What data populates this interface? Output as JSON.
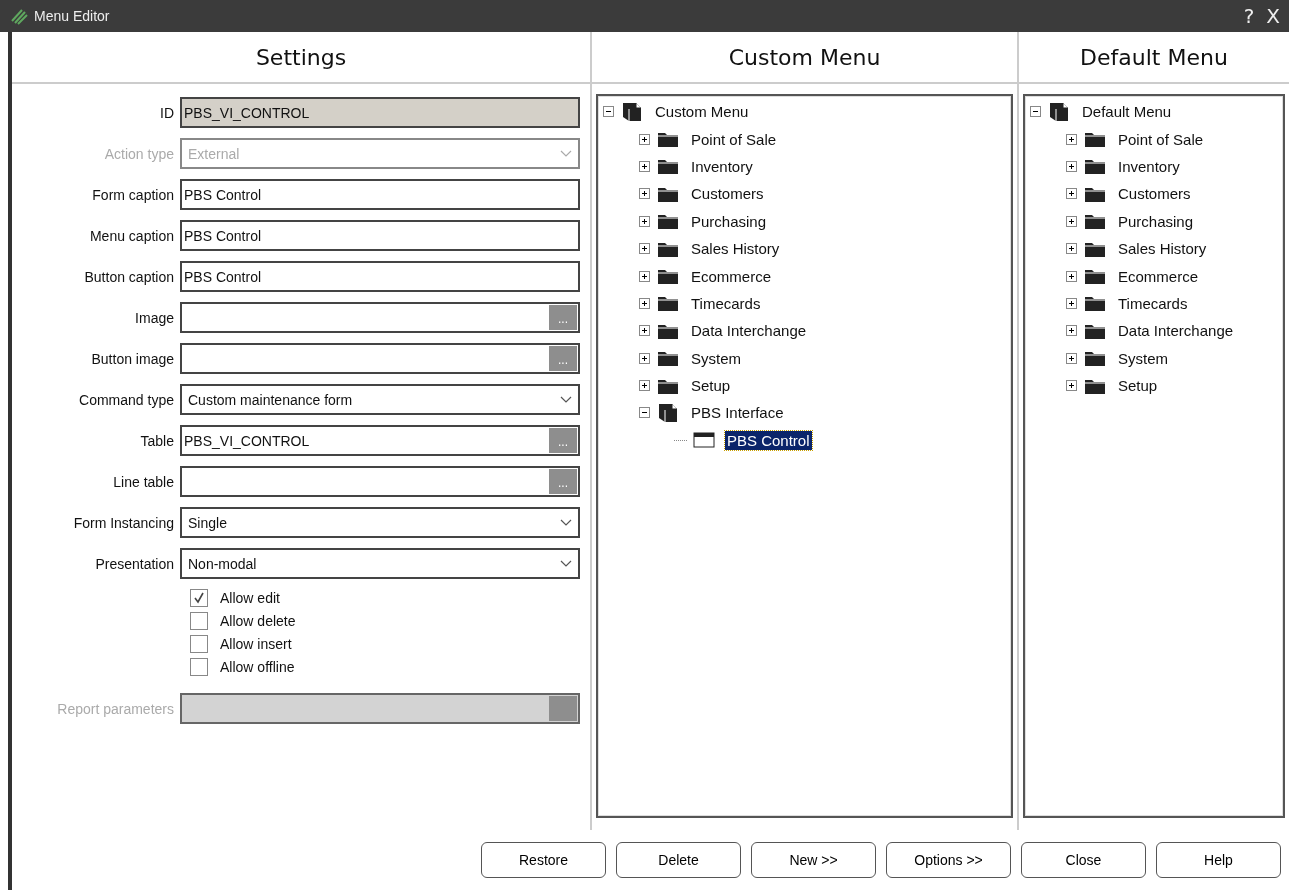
{
  "window": {
    "title": "Menu Editor",
    "help": "?",
    "close": "X"
  },
  "settings": {
    "heading": "Settings",
    "fields": [
      {
        "label": "ID",
        "kind": "text",
        "value": "PBS_VI_CONTROL",
        "readonly": true,
        "disabled": false
      },
      {
        "label": "Action type",
        "kind": "select",
        "value": "External",
        "readonly": false,
        "disabled": true
      },
      {
        "label": "Form caption",
        "kind": "text",
        "value": "PBS Control",
        "readonly": false,
        "disabled": false
      },
      {
        "label": "Menu caption",
        "kind": "text",
        "value": "PBS Control",
        "readonly": false,
        "disabled": false
      },
      {
        "label": "Button caption",
        "kind": "text",
        "value": "PBS Control",
        "readonly": false,
        "disabled": false
      },
      {
        "label": "Image",
        "kind": "browse",
        "button": "...",
        "readonly": false,
        "disabled": false
      },
      {
        "label": "Button image",
        "kind": "browse",
        "button": "...",
        "readonly": false,
        "disabled": false
      },
      {
        "label": "Command type",
        "kind": "select",
        "value": "Custom maintenance form",
        "readonly": false,
        "disabled": false
      },
      {
        "label": "Table",
        "kind": "browse",
        "value": "PBS_VI_CONTROL",
        "button": "...",
        "readonly": false,
        "disabled": false
      },
      {
        "label": "Line table",
        "kind": "browse",
        "button": "...",
        "readonly": false,
        "disabled": false
      },
      {
        "label": "Form Instancing",
        "kind": "select",
        "value": "Single",
        "readonly": false,
        "disabled": false
      },
      {
        "label": "Presentation",
        "kind": "select",
        "value": "Non-modal",
        "readonly": false,
        "disabled": false
      }
    ],
    "checkboxes": [
      {
        "label": "Allow edit",
        "checked": true
      },
      {
        "label": "Allow delete",
        "checked": false
      },
      {
        "label": "Allow insert",
        "checked": false
      },
      {
        "label": "Allow offline",
        "checked": false
      }
    ],
    "report": {
      "label": "Report parameters",
      "kind": "browse",
      "disabled": true
    }
  },
  "custom_menu": {
    "heading": "Custom Menu",
    "tree": [
      {
        "label": "Custom Menu",
        "kind": "menu",
        "expanded": true,
        "selected": false,
        "children": [
          {
            "label": "Point of Sale",
            "kind": "folder",
            "expanded": false,
            "selected": false
          },
          {
            "label": "Inventory",
            "kind": "folder",
            "expanded": false,
            "selected": false
          },
          {
            "label": "Customers",
            "kind": "folder",
            "expanded": false,
            "selected": false
          },
          {
            "label": "Purchasing",
            "kind": "folder",
            "expanded": false,
            "selected": false
          },
          {
            "label": "Sales History",
            "kind": "folder",
            "expanded": false,
            "selected": false
          },
          {
            "label": "Ecommerce",
            "kind": "folder",
            "expanded": false,
            "selected": false
          },
          {
            "label": "Timecards",
            "kind": "folder",
            "expanded": false,
            "selected": false
          },
          {
            "label": "Data Interchange",
            "kind": "folder",
            "expanded": false,
            "selected": false
          },
          {
            "label": "System",
            "kind": "folder",
            "expanded": false,
            "selected": false
          },
          {
            "label": "Setup",
            "kind": "folder",
            "expanded": false,
            "selected": false
          },
          {
            "label": "PBS Interface",
            "kind": "menu",
            "expanded": true,
            "selected": false,
            "children": [
              {
                "label": "PBS Control",
                "kind": "form",
                "selected": true
              }
            ]
          }
        ]
      }
    ]
  },
  "default_menu": {
    "heading": "Default Menu",
    "tree": [
      {
        "label": "Default Menu",
        "kind": "menu",
        "expanded": true,
        "selected": false,
        "children": [
          {
            "label": "Point of Sale",
            "kind": "folder",
            "expanded": false,
            "selected": false
          },
          {
            "label": "Inventory",
            "kind": "folder",
            "expanded": false,
            "selected": false
          },
          {
            "label": "Customers",
            "kind": "folder",
            "expanded": false,
            "selected": false
          },
          {
            "label": "Purchasing",
            "kind": "folder",
            "expanded": false,
            "selected": false
          },
          {
            "label": "Sales History",
            "kind": "folder",
            "expanded": false,
            "selected": false
          },
          {
            "label": "Ecommerce",
            "kind": "folder",
            "expanded": false,
            "selected": false
          },
          {
            "label": "Timecards",
            "kind": "folder",
            "expanded": false,
            "selected": false
          },
          {
            "label": "Data Interchange",
            "kind": "folder",
            "expanded": false,
            "selected": false
          },
          {
            "label": "System",
            "kind": "folder",
            "expanded": false,
            "selected": false
          },
          {
            "label": "Setup",
            "kind": "folder",
            "expanded": false,
            "selected": false
          }
        ]
      }
    ]
  },
  "buttons": [
    "Restore",
    "Delete",
    "New >>",
    "Options >>",
    "Close",
    "Help"
  ]
}
